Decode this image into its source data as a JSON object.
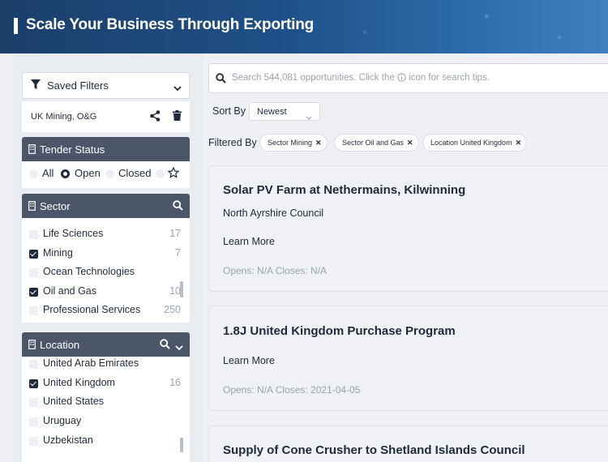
{
  "banner": {
    "title": "Scale Your Business Through Exporting"
  },
  "saved_filters": {
    "label": "Saved Filters",
    "items": [
      {
        "label": "UK Mining, O&G"
      }
    ]
  },
  "tender_status": {
    "title": "Tender Status",
    "options": [
      {
        "label": "All",
        "selected": false
      },
      {
        "label": "Open",
        "selected": true
      },
      {
        "label": "Closed",
        "selected": false
      }
    ]
  },
  "sector": {
    "title": "Sector",
    "items": [
      {
        "label": "Life Sciences",
        "count": "17",
        "checked": false
      },
      {
        "label": "Mining",
        "count": "7",
        "checked": true
      },
      {
        "label": "Ocean Technologies",
        "count": "",
        "checked": false
      },
      {
        "label": "Oil and Gas",
        "count": "10",
        "checked": true
      },
      {
        "label": "Professional Services",
        "count": "250",
        "checked": false
      }
    ]
  },
  "location": {
    "title": "Location",
    "items": [
      {
        "label": "United Arab Emirates",
        "count": "",
        "checked": false
      },
      {
        "label": "United Kingdom",
        "count": "16",
        "checked": true
      },
      {
        "label": "United States",
        "count": "",
        "checked": false
      },
      {
        "label": "Uruguay",
        "count": "",
        "checked": false
      },
      {
        "label": "Uzbekistan",
        "count": "",
        "checked": false
      }
    ]
  },
  "search": {
    "placeholder_before": "Search 544,081 opportunities. Click the",
    "placeholder_after": "icon for search tips."
  },
  "sort": {
    "label": "Sort By",
    "value": "Newest"
  },
  "filters": {
    "label": "Filtered By",
    "chips": [
      "Sector Mining",
      "Sector Oil and Gas",
      "Location United Kingdom"
    ]
  },
  "results": [
    {
      "title": "Solar PV Farm at Nethermains, Kilwinning",
      "org": "North Ayrshire Council",
      "learn": "Learn More",
      "dates": "Opens: N/A  Closes: N/A"
    },
    {
      "title": "1.8J United Kingdom Purchase Program",
      "org": "",
      "learn": "Learn More",
      "dates": "Opens: N/A  Closes: 2021-04-05"
    },
    {
      "title": "Supply of Cone Crusher to Shetland Islands Council",
      "org": "",
      "learn": "",
      "dates": ""
    }
  ],
  "colors": {
    "panel_header": "#4b5669",
    "banner": "#1e4f86",
    "text": "#1f2a3a"
  },
  "icons": [
    "filter-icon",
    "chevron-down-icon",
    "share-icon",
    "trash-icon",
    "building-icon",
    "star-icon",
    "search-icon",
    "info-icon",
    "close-icon"
  ]
}
